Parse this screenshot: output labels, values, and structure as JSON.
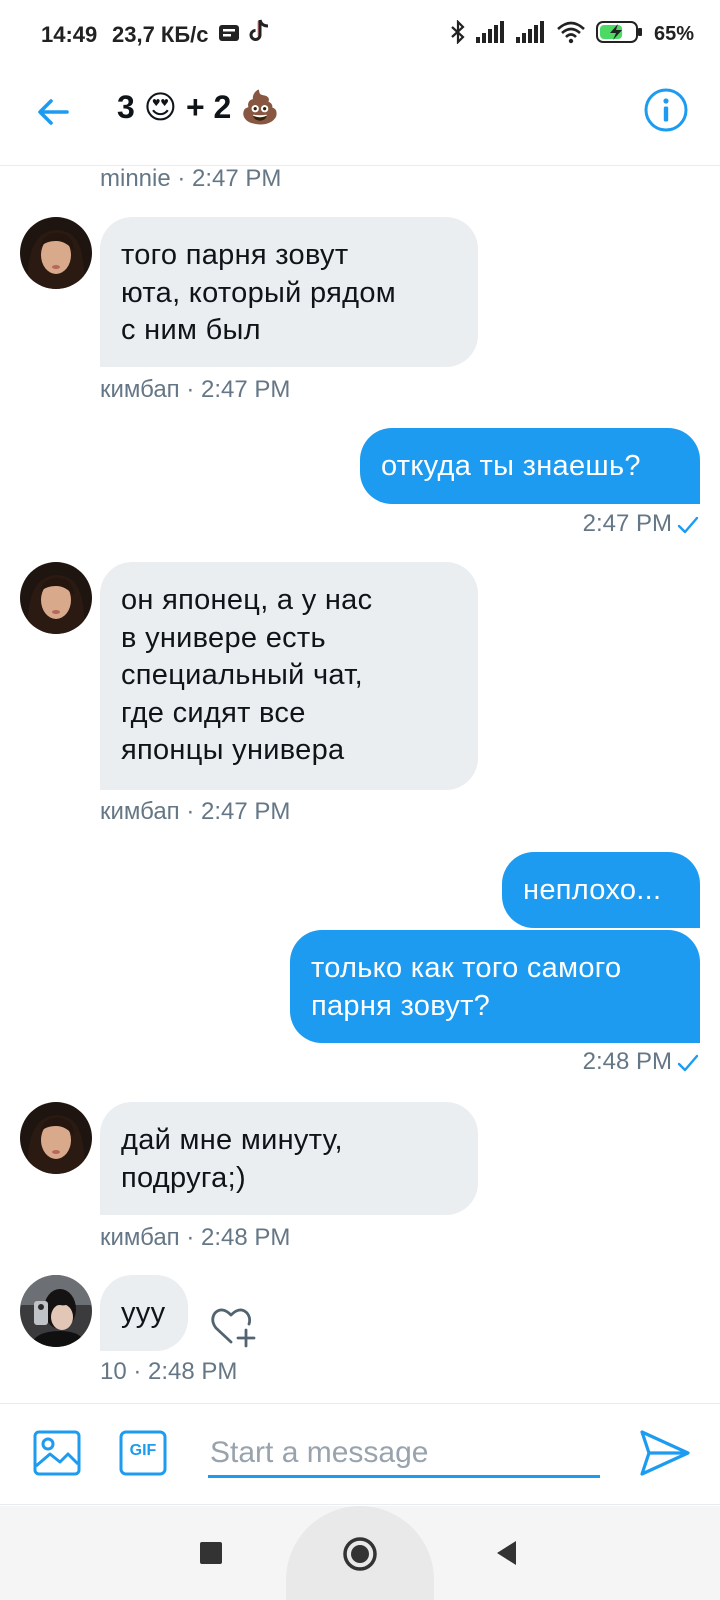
{
  "status_bar": {
    "time": "14:49",
    "speed": "23,7 КБ/с",
    "battery_percent": "65%",
    "battery_level": 0.65,
    "icons": [
      "message-icon",
      "tiktok-icon",
      "bluetooth-icon",
      "signal-icon",
      "signal-icon",
      "wifi-icon",
      "battery-charging-icon"
    ]
  },
  "header": {
    "back_icon": "arrow-left-icon",
    "title": "3 😍 + 2 💩",
    "info_icon": "info-icon"
  },
  "messages": {
    "top_meta": "minnie · 2:47 PM",
    "m1": {
      "lines": [
        "того парня зовут",
        "юта, который рядом",
        "с ним был"
      ],
      "meta": "кимбап · 2:47 PM"
    },
    "m2": {
      "text": "откуда ты знаешь?",
      "meta": "2:47 PM"
    },
    "m3": {
      "lines": [
        "он японец, а у нас",
        "в универе есть",
        "специальный чат,",
        "где сидят все",
        "японцы универа"
      ],
      "meta": "кимбап · 2:47 PM"
    },
    "m4": {
      "text": "неплохо..."
    },
    "m5": {
      "lines": [
        "только как того самого",
        "парня зовут?"
      ],
      "meta": "2:48 PM"
    },
    "m6": {
      "lines": [
        "дай мне минуту,",
        "подруга;)"
      ],
      "meta": "кимбап · 2:48 PM"
    },
    "m7": {
      "text": "ууу",
      "meta": "10 · 2:48 PM",
      "like_icon": "heart-add-icon"
    }
  },
  "composer": {
    "placeholder": "Start a message",
    "image_icon": "image-icon",
    "gif_label": "GIF",
    "send_icon": "send-icon"
  },
  "nav_bar": {
    "icons": [
      "square-recents-icon",
      "circle-home-icon",
      "triangle-back-icon"
    ]
  },
  "colors": {
    "accent": "#1d9bf0",
    "incoming_bubble": "#ebeef0",
    "meta_text": "#657786"
  }
}
